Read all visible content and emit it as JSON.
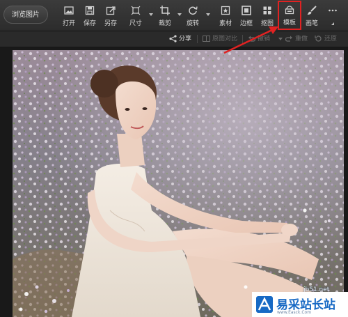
{
  "toolbar": {
    "browse_label": "浏览图片",
    "tools": [
      {
        "label": "打开",
        "icon": "open-image-icon"
      },
      {
        "label": "保存",
        "icon": "save-icon"
      },
      {
        "label": "另存",
        "icon": "save-as-icon"
      },
      {
        "label": "尺寸",
        "icon": "resize-icon"
      },
      {
        "label": "裁剪",
        "icon": "crop-icon"
      },
      {
        "label": "旋转",
        "icon": "rotate-icon"
      },
      {
        "label": "素材",
        "icon": "material-icon"
      },
      {
        "label": "边框",
        "icon": "border-icon"
      },
      {
        "label": "抠图",
        "icon": "cutout-icon"
      },
      {
        "label": "模板",
        "icon": "template-icon",
        "highlighted": true
      },
      {
        "label": "画笔",
        "icon": "brush-icon"
      },
      {
        "label": "",
        "icon": "more-icon"
      }
    ]
  },
  "subbar": {
    "share": "分享",
    "compare": "原图对比",
    "undo": "撤销",
    "redo": "重做",
    "restore": "还原"
  },
  "watermark": {
    "url": "jb51.net",
    "logo_text": "易采站长站",
    "logo_sub": "www.Easck.Com"
  },
  "colors": {
    "accent": "#e02222",
    "toolbar_bg": "#333333",
    "logo_blue": "#1769c4"
  }
}
